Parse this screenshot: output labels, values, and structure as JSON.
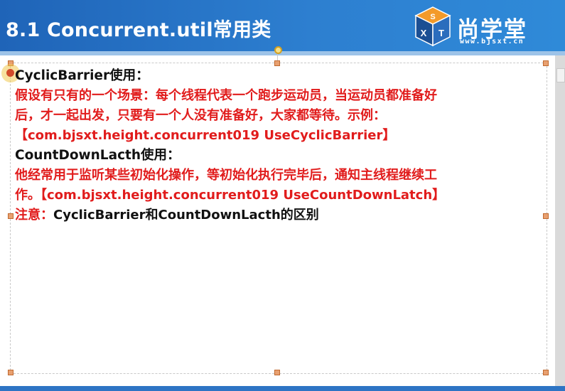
{
  "slide": {
    "title": "8.1 Concurrent.util常用类"
  },
  "logo": {
    "cube_letters": [
      "S",
      "X",
      "T"
    ],
    "cn_name": "尚学堂",
    "url": "www.bjsxt.cn"
  },
  "content": {
    "heading1": "CyclicBarrier使用：",
    "para1_line1": "假设有只有的一个场景：每个线程代表一个跑步运动员，当运动员都准备好",
    "para1_line2": "后，才一起出发，只要有一个人没有准备好，大家都等待。示例：",
    "para1_line3": "【com.bjsxt.height.concurrent019 UseCyclicBarrier】",
    "heading2": "CountDownLacth使用：",
    "para2_line1": "他经常用于监听某些初始化操作，等初始化执行完毕后，通知主线程继续工",
    "para2_line2": "作。【com.bjsxt.height.concurrent019 UseCountDownLatch】",
    "note_label": "注意：",
    "note_text": "CyclicBarrier和CountDownLacth的区别"
  },
  "colors": {
    "header_blue": "#1f64b8",
    "highlight_red": "#e11c1c",
    "body_text": "#111111"
  }
}
